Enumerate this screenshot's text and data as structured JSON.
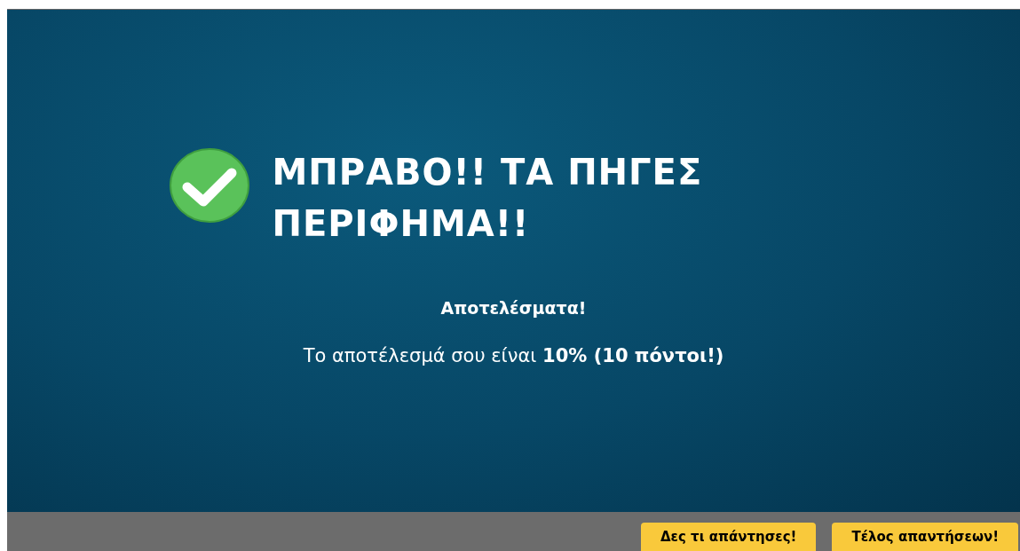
{
  "result": {
    "heading": "ΜΠΡΑΒΟ!! ΤΑ ΠΗΓΕΣ ΠΕΡΙΦΗΜΑ!!",
    "subtitle": "Αποτελέσματα!",
    "score_text": "Το αποτέλεσμά σου είναι **10% (10 πόντοι!)**"
  },
  "buttons": [
    {
      "label": "Δες τι απάντησες!"
    },
    {
      "label": "Τέλος απαντήσεων!"
    }
  ]
}
